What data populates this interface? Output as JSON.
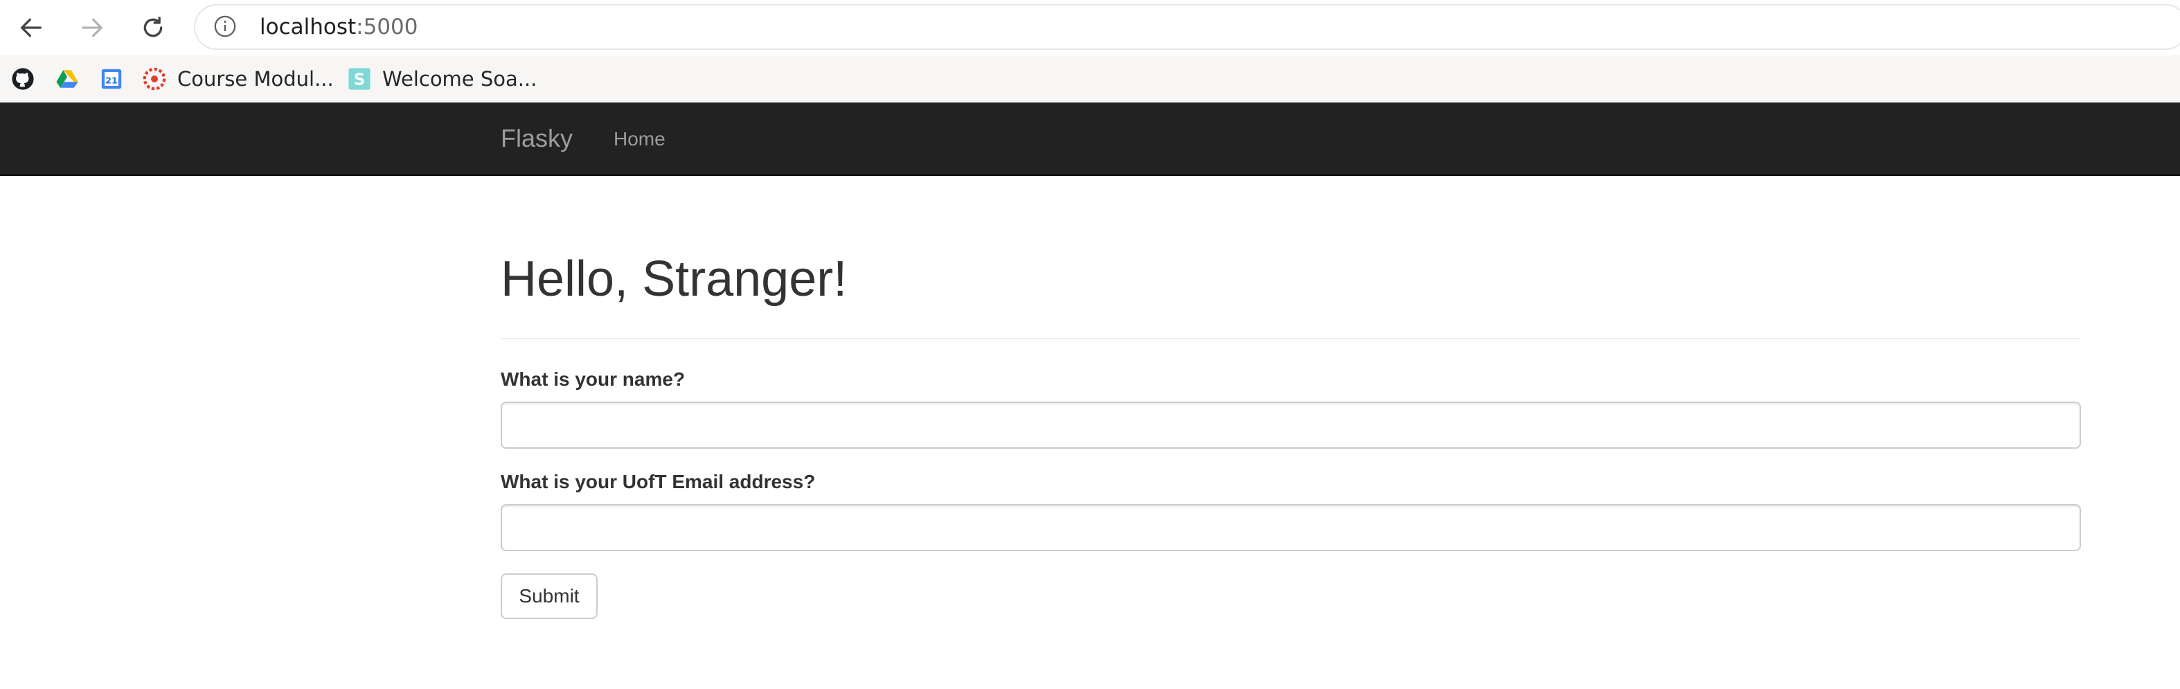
{
  "browser": {
    "url_host": "localhost",
    "url_port": ":5000",
    "bookmarks": [
      {
        "icon": "github-icon",
        "label": ""
      },
      {
        "icon": "google-drive-icon",
        "label": ""
      },
      {
        "icon": "google-calendar-icon",
        "label": "21"
      },
      {
        "icon": "course-module-icon",
        "label": "Course Modul..."
      },
      {
        "icon": "soa-icon",
        "label": "Welcome Soa..."
      }
    ]
  },
  "navbar": {
    "brand": "Flasky",
    "links": [
      "Home"
    ],
    "background": "#222222",
    "link_color": "#9d9d9d"
  },
  "page": {
    "heading": "Hello, Stranger!",
    "form": {
      "name_label": "What is your name?",
      "name_value": "",
      "email_label": "What is your UofT Email address?",
      "email_value": "",
      "submit_label": "Submit"
    }
  }
}
